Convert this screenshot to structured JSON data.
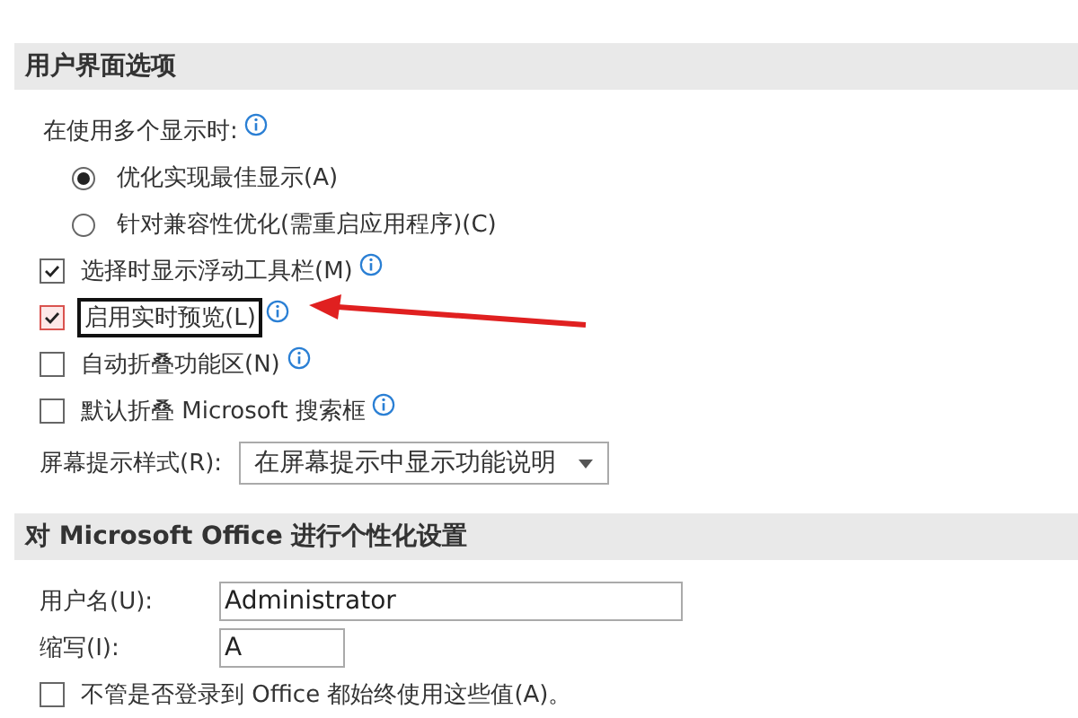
{
  "sections": [
    {
      "title": "用户界面选项",
      "items": [
        {
          "kind": "heading",
          "label": "在使用多个显示时:",
          "info": true
        },
        {
          "kind": "radio",
          "label": "优化实现最佳显示(A)",
          "selected": true
        },
        {
          "kind": "radio",
          "label": "针对兼容性优化(需重启应用程序)(C)",
          "selected": false
        },
        {
          "kind": "checkbox",
          "label": "选择时显示浮动工具栏(M)",
          "checked": true,
          "info": true,
          "highlighted": false
        },
        {
          "kind": "checkbox",
          "label": "启用实时预览(L)",
          "checked": true,
          "info": true,
          "highlighted": true
        },
        {
          "kind": "checkbox",
          "label": "自动折叠功能区(N)",
          "checked": false,
          "info": true,
          "highlighted": false
        },
        {
          "kind": "checkbox",
          "label": "默认折叠 Microsoft 搜索框",
          "checked": false,
          "info": true,
          "highlighted": false
        },
        {
          "kind": "dropdown",
          "label": "屏幕提示样式(R):",
          "value": "在屏幕提示中显示功能说明"
        }
      ]
    },
    {
      "title": "对 Microsoft Office 进行个性化设置",
      "items": [
        {
          "kind": "text",
          "label": "用户名(U):",
          "value": "Administrator",
          "wide": true
        },
        {
          "kind": "text",
          "label": "缩写(I):",
          "value": "A",
          "wide": false
        },
        {
          "kind": "checkbox",
          "label": "不管是否登录到 Office 都始终使用这些值(A)。",
          "checked": false,
          "info": false,
          "highlighted": false
        }
      ]
    }
  ]
}
